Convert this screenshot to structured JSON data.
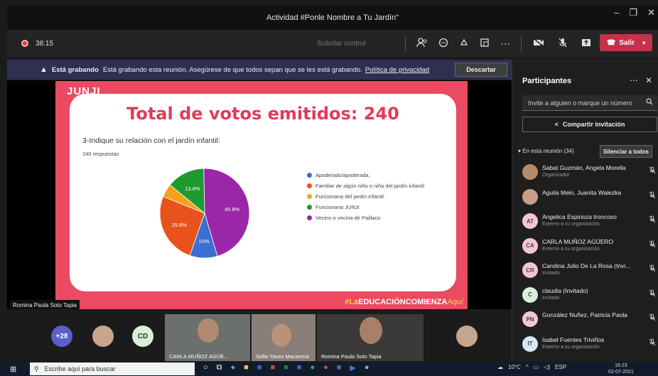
{
  "window": {
    "title": "Actividad #Ponle Nombre a Tu Jardín\"",
    "minimize": "–",
    "maximize": "❐",
    "close": "✕"
  },
  "toolbar": {
    "timer": "38:15",
    "request_control": "Solicitar control",
    "leave_label": "Salir"
  },
  "banner": {
    "heading": "Está grabando",
    "message": "Está grabando esta reunión. Asegúrese de que todos sepan que se les está grabando.",
    "link": "Política de privacidad",
    "dismiss": "Descartar"
  },
  "slide": {
    "brand": "JUNJI",
    "title": "Total de votos emitidos: 240",
    "question": "3-Indique su relación con el jardín infantil:",
    "responses": "240 respuestas",
    "footer_hash": "#",
    "footer_la": "La",
    "footer_main": "EDUCACIÓNCOMIENZA",
    "footer_aqui": "Aquí",
    "presenter": "Romina Paula Soto Tapia"
  },
  "chart_data": {
    "type": "pie",
    "title": "3-Indique su relación con el jardín infantil:",
    "labels": [
      "Apoderado/apoderada.",
      "Familiar de algún niño o niña del jardín infantil",
      "Funcionaria del jardín infantil.",
      "Funcionaria JUNJI",
      "Vecino o vecina de Paillaco"
    ],
    "values": [
      10,
      25.8,
      4.8,
      13.8,
      45.8
    ],
    "value_labels": [
      "10%",
      "25.8%",
      "",
      "13.8%",
      "45.8%"
    ],
    "colors": [
      "#3b6fd4",
      "#e8521c",
      "#f4a21c",
      "#1e9a2e",
      "#9b26a8"
    ]
  },
  "strip": {
    "more_count": "+28",
    "cd_initials": "CD",
    "tile1_name": "CARLA MUÑOZ AGÜE...",
    "tile2_name": "Sofia Yaves Macarena",
    "tile3_name": "Romina Paula Soto Tapia"
  },
  "participants": {
    "title": "Participantes",
    "invite_placeholder": "Invite a alguien o marque un número",
    "share_label": "Compartir invitación",
    "in_meeting": "En esta reunión (34)",
    "mute_all": "Silenciar a todos",
    "list": [
      {
        "initials": "",
        "name": "Sabat Guzmán, Angela Morella",
        "sub": "Organizador",
        "color": "#b58a6a"
      },
      {
        "initials": "",
        "name": "Aguila Melo, Juanita Walezka",
        "sub": "",
        "color": "#c99f8a"
      },
      {
        "initials": "AT",
        "name": "Angelica Espinoza troncoso",
        "sub": "Externo a su organización",
        "color": "#f3c7d2"
      },
      {
        "initials": "CA",
        "name": "CARLA MUÑOZ AGÜERO",
        "sub": "Externo a su organización",
        "color": "#f3c7d2"
      },
      {
        "initials": "CR",
        "name": "Carolina Julio De La Rosa (Invi...",
        "sub": "Invitado",
        "color": "#f3c7d2"
      },
      {
        "initials": "C",
        "name": "claudia (Invitado)",
        "sub": "Invitado",
        "color": "#d9efd9"
      },
      {
        "initials": "PN",
        "name": "González Nuñez, Patricia Paola",
        "sub": "",
        "color": "#f3c7d2"
      },
      {
        "initials": "IT",
        "name": "Isabel Fuentes Triviños",
        "sub": "Externo a su organización",
        "color": "#d7e6f3"
      }
    ]
  },
  "taskbar": {
    "search_placeholder": "Escribe aquí para buscar",
    "temperature": "10°C",
    "language": "ESP",
    "time": "16:23",
    "date": "02-07-2021"
  }
}
